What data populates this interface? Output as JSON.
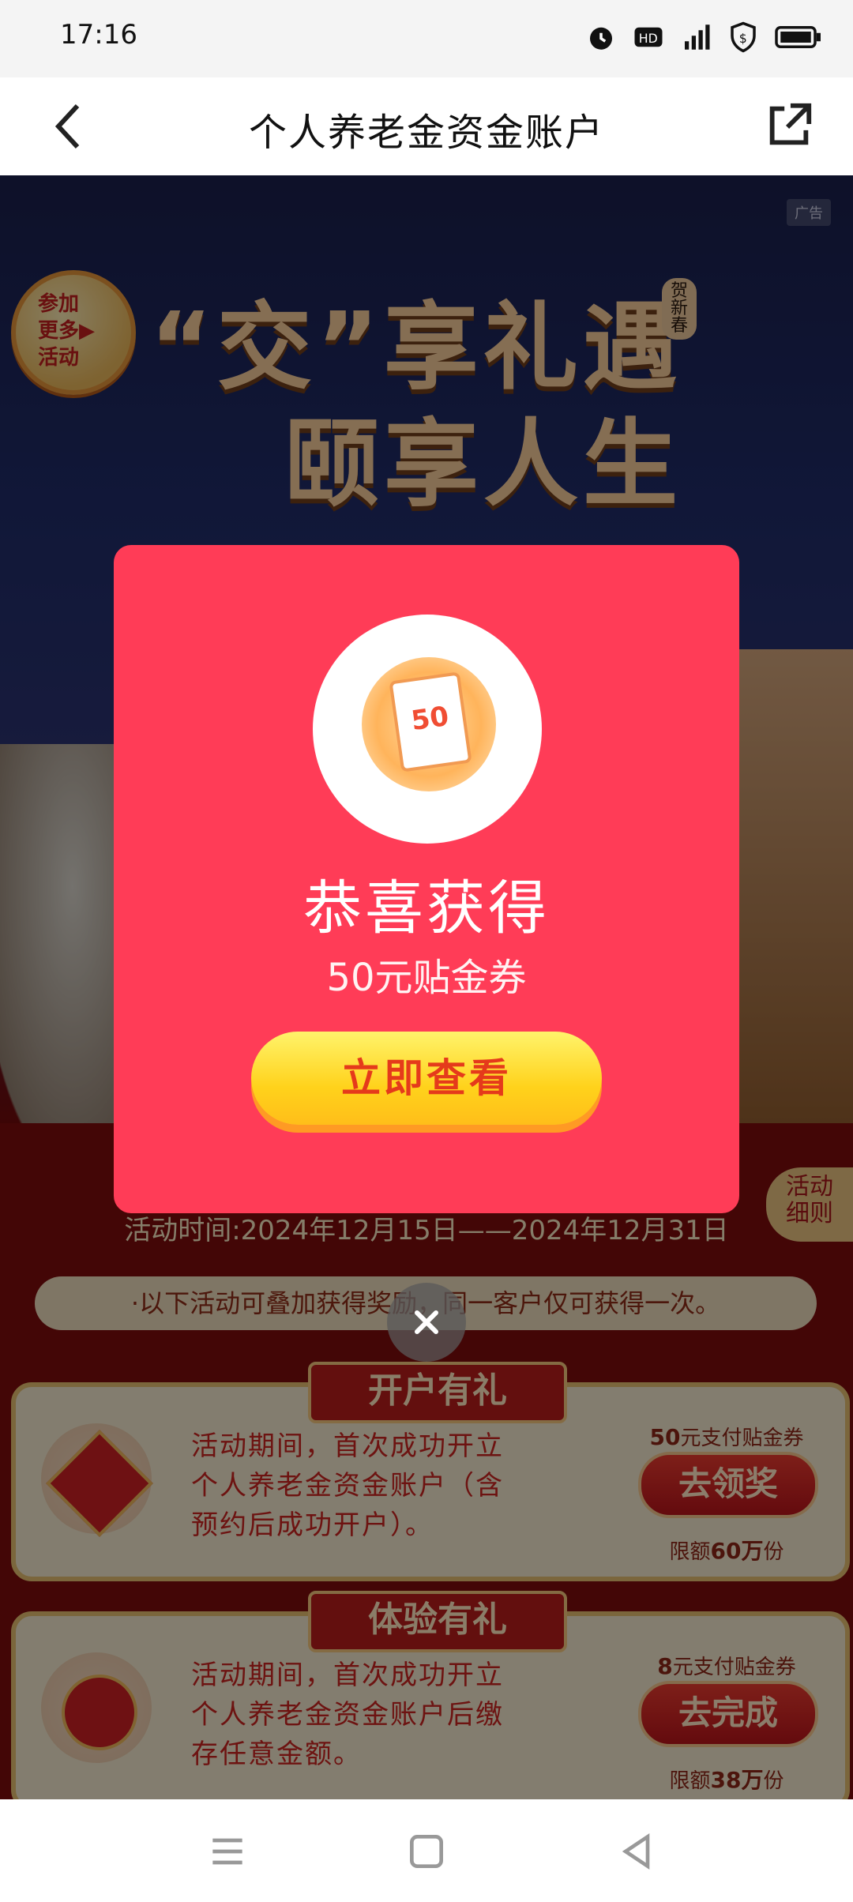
{
  "status_bar": {
    "time": "17:16"
  },
  "header": {
    "title": "个人养老金资金账户"
  },
  "banner": {
    "ad_badge": "广告",
    "join_more": "参加\n更多▶\n活动",
    "headline_line1": "“交”享礼遇",
    "headline_line2": "颐享人生",
    "seal_text": "贺新春"
  },
  "popup": {
    "title": "恭喜获得",
    "subtitle": "50元贴金券",
    "button_label": "立即查看",
    "coupon_number": "50"
  },
  "activity": {
    "time": "活动时间:2024年12月15日——2024年12月31日",
    "rules_button": "活动\n细则",
    "notice": "·以下活动可叠加获得奖励，同一客户仅可获得一次。"
  },
  "cards": [
    {
      "ribbon": "开户有礼",
      "description": "活动期间，首次成功开立个人养老金资金账户（含预约后成功开户）。",
      "reward_amount": "50",
      "reward_unit": "元支付贴金券",
      "button_label": "去领奖",
      "limit_prefix": "限额",
      "limit_value": "60万",
      "limit_suffix": "份"
    },
    {
      "ribbon": "体验有礼",
      "description": "活动期间，首次成功开立个人养老金资金账户后缴存任意金额。",
      "reward_amount": "8",
      "reward_unit": "元支付贴金券",
      "button_label": "去完成",
      "limit_prefix": "限额",
      "limit_value": "38万",
      "limit_suffix": "份"
    }
  ]
}
